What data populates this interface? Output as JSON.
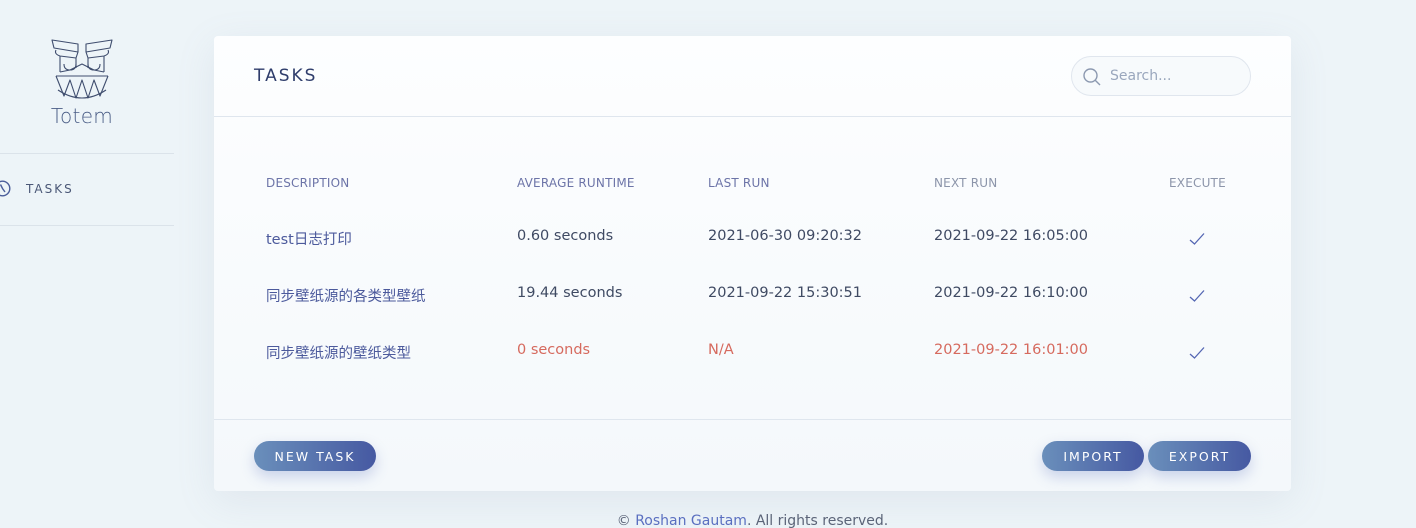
{
  "app": {
    "brand": "Totem"
  },
  "sidebar": {
    "items": [
      {
        "label": "TASKS",
        "icon": "clock-icon"
      }
    ]
  },
  "card": {
    "title": "TASKS",
    "search": {
      "placeholder": "Search...",
      "value": ""
    }
  },
  "table": {
    "columns": [
      "DESCRIPTION",
      "AVERAGE RUNTIME",
      "LAST RUN",
      "NEXT RUN",
      "EXECUTE"
    ],
    "rows": [
      {
        "description": "test日志打印",
        "average_runtime": "0.60 seconds",
        "last_run": "2021-06-30 09:20:32",
        "next_run": "2021-09-22 16:05:00",
        "execute_icon": "check-icon",
        "error": false
      },
      {
        "description": "同步壁纸源的各类型壁纸",
        "average_runtime": "19.44 seconds",
        "last_run": "2021-09-22 15:30:51",
        "next_run": "2021-09-22 16:10:00",
        "execute_icon": "check-icon",
        "error": false
      },
      {
        "description": "同步壁纸源的壁纸类型",
        "average_runtime": "0 seconds",
        "last_run": "N/A",
        "next_run": "2021-09-22 16:01:00",
        "execute_icon": "check-icon",
        "error": true
      }
    ]
  },
  "footer_buttons": {
    "new_task": "NEW TASK",
    "import": "IMPORT",
    "export": "EXPORT"
  },
  "footer": {
    "copyright_symbol": "©",
    "author": "Roshan Gautam",
    "rights": ". All rights reserved."
  },
  "colors": {
    "accent_start": "#6a8fbb",
    "accent_end": "#4659a2",
    "error": "#d66a5e",
    "background": "#edf4f8"
  }
}
